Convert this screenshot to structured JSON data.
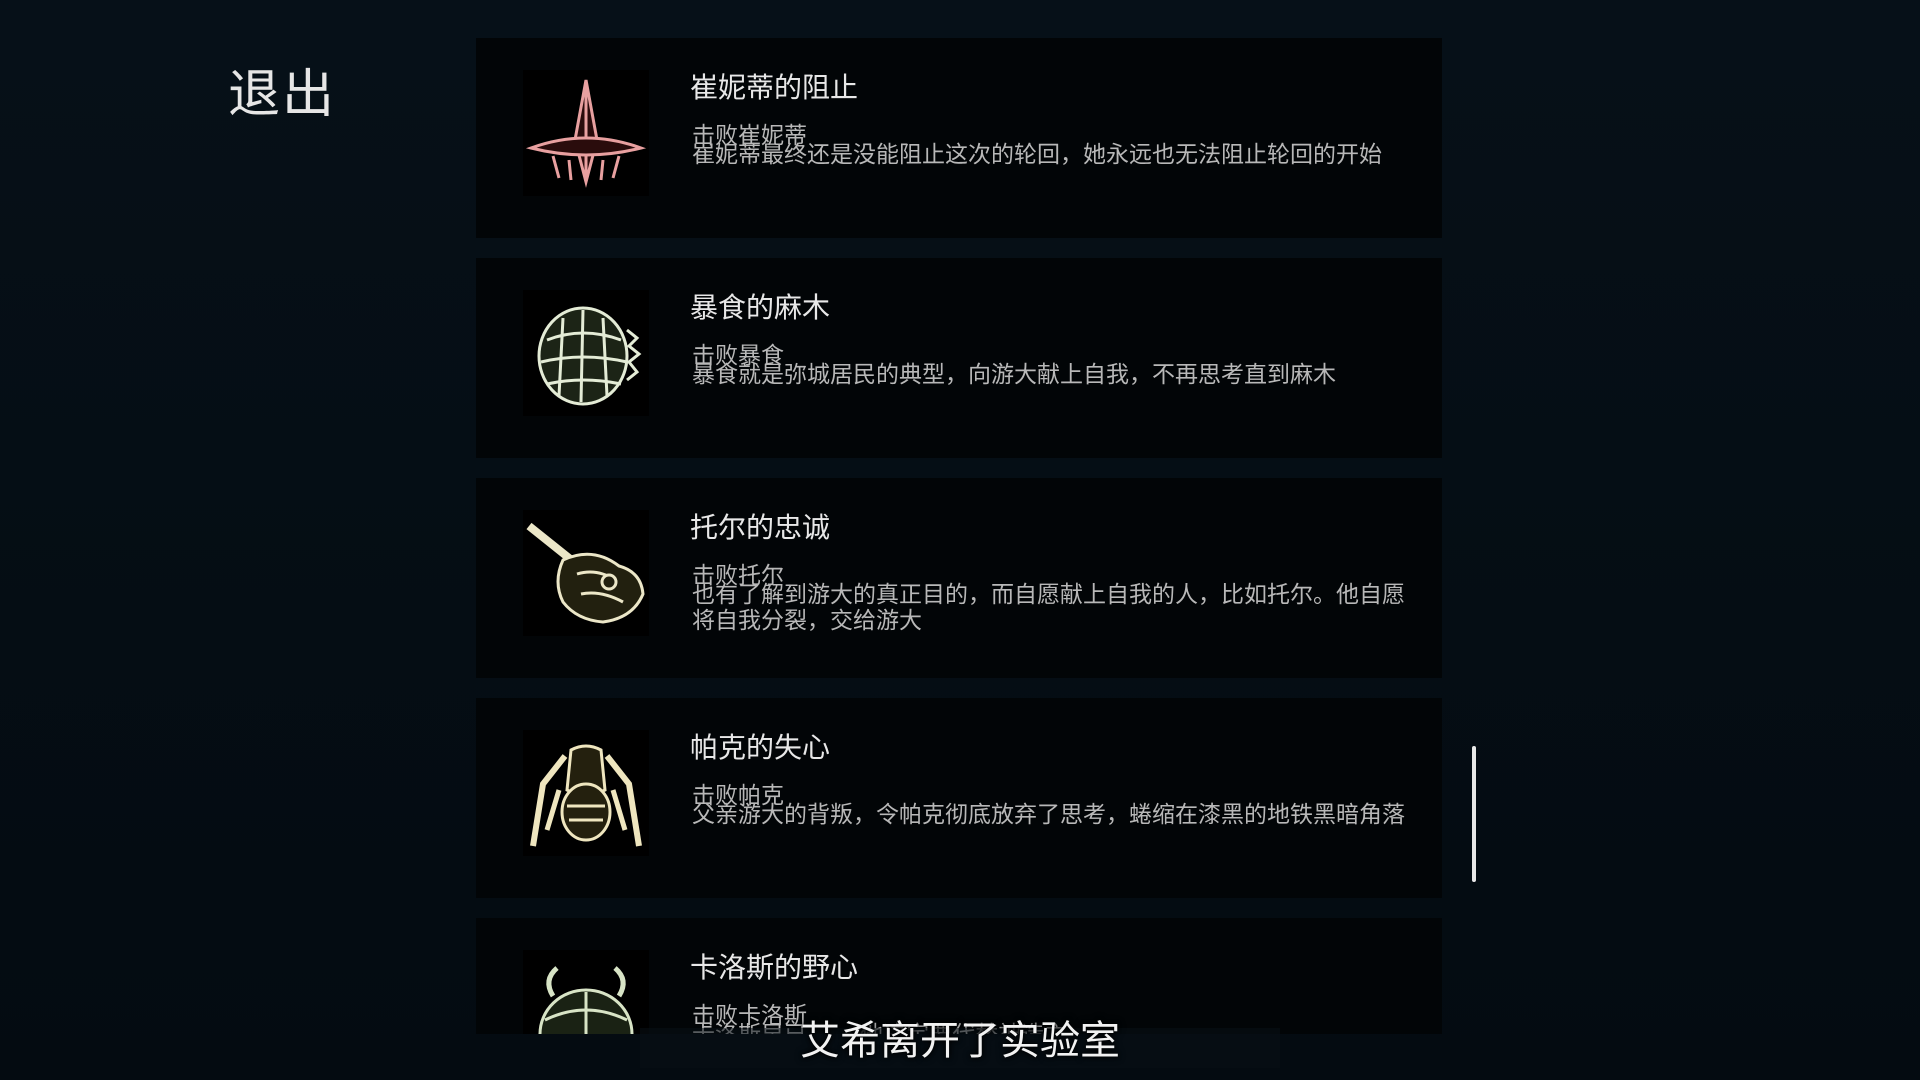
{
  "exit_label": "退出",
  "achievements": [
    {
      "title": "崔妮蒂的阻止",
      "condition": "击败崔妮蒂",
      "description": "崔妮蒂最终还是没能阻止这次的轮回，她永远也无法阻止轮回的开始",
      "icon": "winged-dart-icon",
      "icon_color": "#e8a0a0"
    },
    {
      "title": "暴食的麻木",
      "condition": "击败暴食",
      "description": "暴食就是弥城居民的典型，向游大献上自我，不再思考直到麻木",
      "icon": "armored-shell-icon",
      "icon_color": "#e4ecd6"
    },
    {
      "title": "托尔的忠诚",
      "condition": "击败托尔",
      "description": "也有了解到游大的真正目的，而自愿献上自我的人，比如托尔。他自愿将自我分裂，交给游大",
      "icon": "cannon-beast-icon",
      "icon_color": "#ece7c8"
    },
    {
      "title": "帕克的失心",
      "condition": "击败帕克",
      "description": "父亲游大的背叛，令帕克彻底放弃了思考，蜷缩在漆黑的地铁黑暗角落",
      "icon": "spider-mech-icon",
      "icon_color": "#efe6bf"
    },
    {
      "title": "卡洛斯的野心",
      "condition": "击败卡洛斯",
      "description": "卡洛斯早已…… 他决定要代替神造之",
      "icon": "beetle-mech-icon",
      "icon_color": "#d8e4c6"
    }
  ],
  "subtitle": "艾希离开了实验室"
}
